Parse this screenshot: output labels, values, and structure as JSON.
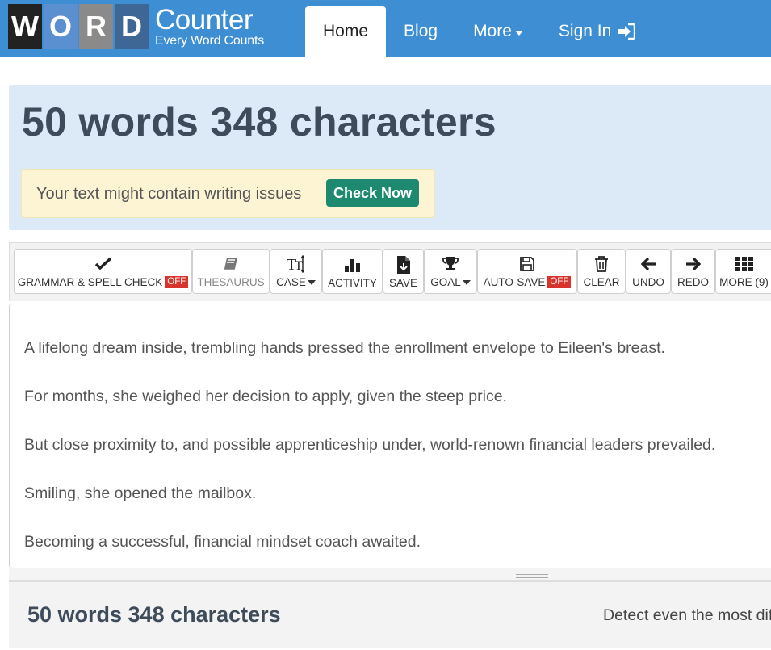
{
  "logo": {
    "letters": [
      "W",
      "O",
      "R",
      "D"
    ],
    "main": "Counter",
    "tagline": "Every Word Counts"
  },
  "nav": {
    "home": "Home",
    "blog": "Blog",
    "more": "More",
    "signin": "Sign In"
  },
  "stats": {
    "headline": "50 words 348 characters"
  },
  "issues": {
    "message": "Your text might contain writing issues",
    "button": "Check Now"
  },
  "toolbar": {
    "grammar": {
      "label": "GRAMMAR & SPELL CHECK",
      "badge": "OFF",
      "icon": "check-icon"
    },
    "thesaurus": {
      "label": "THESAURUS",
      "icon": "book-icon"
    },
    "case": {
      "label": "CASE",
      "icon": "text-case-icon"
    },
    "activity": {
      "label": "ACTIVITY",
      "icon": "bar-chart-icon"
    },
    "save": {
      "label": "SAVE",
      "icon": "file-download-icon"
    },
    "goal": {
      "label": "GOAL",
      "icon": "trophy-icon"
    },
    "autosave": {
      "label": "AUTO-SAVE",
      "badge": "OFF",
      "icon": "floppy-icon"
    },
    "clear": {
      "label": "CLEAR",
      "icon": "trash-icon"
    },
    "undo": {
      "label": "UNDO",
      "icon": "arrow-left-icon"
    },
    "redo": {
      "label": "REDO",
      "icon": "arrow-right-icon"
    },
    "more": {
      "label": "MORE (9)",
      "icon": "grid-icon"
    }
  },
  "editor": {
    "lines": [
      "A lifelong dream inside, trembling hands pressed the enrollment envelope to Eileen's breast.",
      "For months, she weighed her decision to apply, given the steep price.",
      "But close proximity to, and possible apprenticeship under, world-renown financial leaders prevailed.",
      "Smiling, she opened the mailbox.",
      "Becoming a successful, financial mindset coach awaited."
    ]
  },
  "footer": {
    "count": "50 words 348 characters",
    "detect": "Detect even the most difficult"
  },
  "colors": {
    "navbar": "#3e8ed4",
    "panel": "#dbeaf6",
    "check_button": "#1d8a6f",
    "off_badge": "#d9342b"
  }
}
